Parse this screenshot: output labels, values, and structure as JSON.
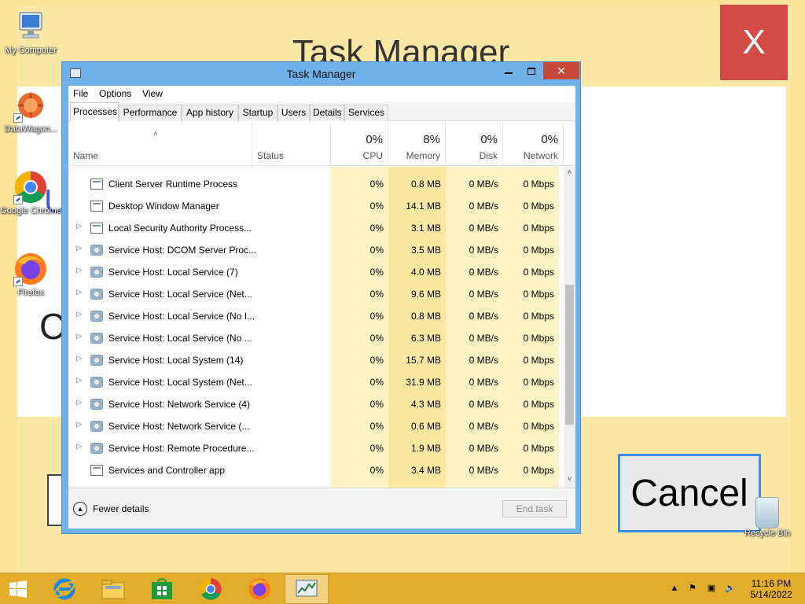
{
  "background_app": {
    "title": "Task Manager",
    "close_label": "X",
    "cancel_label": "Cancel"
  },
  "desktop_icons": [
    {
      "name": "my-computer",
      "label": "My Computer"
    },
    {
      "name": "datawagon",
      "label": "DataWagon..."
    },
    {
      "name": "google-chrome",
      "label": "Google Chrome"
    },
    {
      "name": "firefox",
      "label": "Firefox"
    }
  ],
  "recycle_bin": {
    "label": "Recycle Bin"
  },
  "task_manager": {
    "title": "Task Manager",
    "menu": [
      "File",
      "Options",
      "View"
    ],
    "tabs": [
      "Processes",
      "Performance",
      "App history",
      "Startup",
      "Users",
      "Details",
      "Services"
    ],
    "active_tab": "Processes",
    "columns": {
      "name": "Name",
      "status": "Status",
      "cpu": {
        "pct": "0%",
        "label": "CPU"
      },
      "memory": {
        "pct": "8%",
        "label": "Memory"
      },
      "disk": {
        "pct": "0%",
        "label": "Disk"
      },
      "network": {
        "pct": "0%",
        "label": "Network"
      }
    },
    "processes": [
      {
        "name": "Client Server Runtime Process",
        "expandable": false,
        "icon": "app-window-icon",
        "cpu": "0%",
        "memory": "0.8 MB",
        "disk": "0 MB/s",
        "network": "0 Mbps"
      },
      {
        "name": "Desktop Window Manager",
        "expandable": false,
        "icon": "app-window-icon",
        "cpu": "0%",
        "memory": "14.1 MB",
        "disk": "0 MB/s",
        "network": "0 Mbps"
      },
      {
        "name": "Local Security Authority Process...",
        "expandable": true,
        "icon": "app-window-icon",
        "cpu": "0%",
        "memory": "3.1 MB",
        "disk": "0 MB/s",
        "network": "0 Mbps"
      },
      {
        "name": "Service Host: DCOM Server Proc...",
        "expandable": true,
        "icon": "gear-icon",
        "cpu": "0%",
        "memory": "3.5 MB",
        "disk": "0 MB/s",
        "network": "0 Mbps"
      },
      {
        "name": "Service Host: Local Service (7)",
        "expandable": true,
        "icon": "gear-icon",
        "cpu": "0%",
        "memory": "4.0 MB",
        "disk": "0 MB/s",
        "network": "0 Mbps"
      },
      {
        "name": "Service Host: Local Service (Net...",
        "expandable": true,
        "icon": "gear-icon",
        "cpu": "0%",
        "memory": "9.6 MB",
        "disk": "0 MB/s",
        "network": "0 Mbps"
      },
      {
        "name": "Service Host: Local Service (No I...",
        "expandable": true,
        "icon": "gear-icon",
        "cpu": "0%",
        "memory": "0.8 MB",
        "disk": "0 MB/s",
        "network": "0 Mbps"
      },
      {
        "name": "Service Host: Local Service (No ...",
        "expandable": true,
        "icon": "gear-icon",
        "cpu": "0%",
        "memory": "6.3 MB",
        "disk": "0 MB/s",
        "network": "0 Mbps"
      },
      {
        "name": "Service Host: Local System (14)",
        "expandable": true,
        "icon": "gear-icon",
        "cpu": "0%",
        "memory": "15.7 MB",
        "disk": "0 MB/s",
        "network": "0 Mbps"
      },
      {
        "name": "Service Host: Local System (Net...",
        "expandable": true,
        "icon": "gear-icon",
        "cpu": "0%",
        "memory": "31.9 MB",
        "disk": "0 MB/s",
        "network": "0 Mbps"
      },
      {
        "name": "Service Host: Network Service (4)",
        "expandable": true,
        "icon": "gear-icon",
        "cpu": "0%",
        "memory": "4.3 MB",
        "disk": "0 MB/s",
        "network": "0 Mbps"
      },
      {
        "name": "Service Host: Network Service (...",
        "expandable": true,
        "icon": "gear-icon",
        "cpu": "0%",
        "memory": "0.6 MB",
        "disk": "0 MB/s",
        "network": "0 Mbps"
      },
      {
        "name": "Service Host: Remote Procedure...",
        "expandable": true,
        "icon": "gear-icon",
        "cpu": "0%",
        "memory": "1.9 MB",
        "disk": "0 MB/s",
        "network": "0 Mbps"
      },
      {
        "name": "Services and Controller app",
        "expandable": false,
        "icon": "app-window-icon",
        "cpu": "0%",
        "memory": "3.4 MB",
        "disk": "0 MB/s",
        "network": "0 Mbps"
      }
    ],
    "footer": {
      "fewer_details": "Fewer details",
      "end_task": "End task"
    }
  },
  "taskbar": {
    "apps": [
      "start",
      "internet-explorer",
      "file-explorer",
      "store",
      "google-chrome",
      "firefox",
      "task-manager"
    ],
    "active_app": "task-manager",
    "time": "11:16 PM",
    "date": "5/14/2022"
  },
  "colors": {
    "desktop": "#f6c654",
    "window_frame": "#6fb1e9",
    "close_button": "#c7473a",
    "cpu_heat": "#fdf3c5",
    "memory_heat": "#fbe9a2",
    "taskbar": "#e2ad2b"
  }
}
